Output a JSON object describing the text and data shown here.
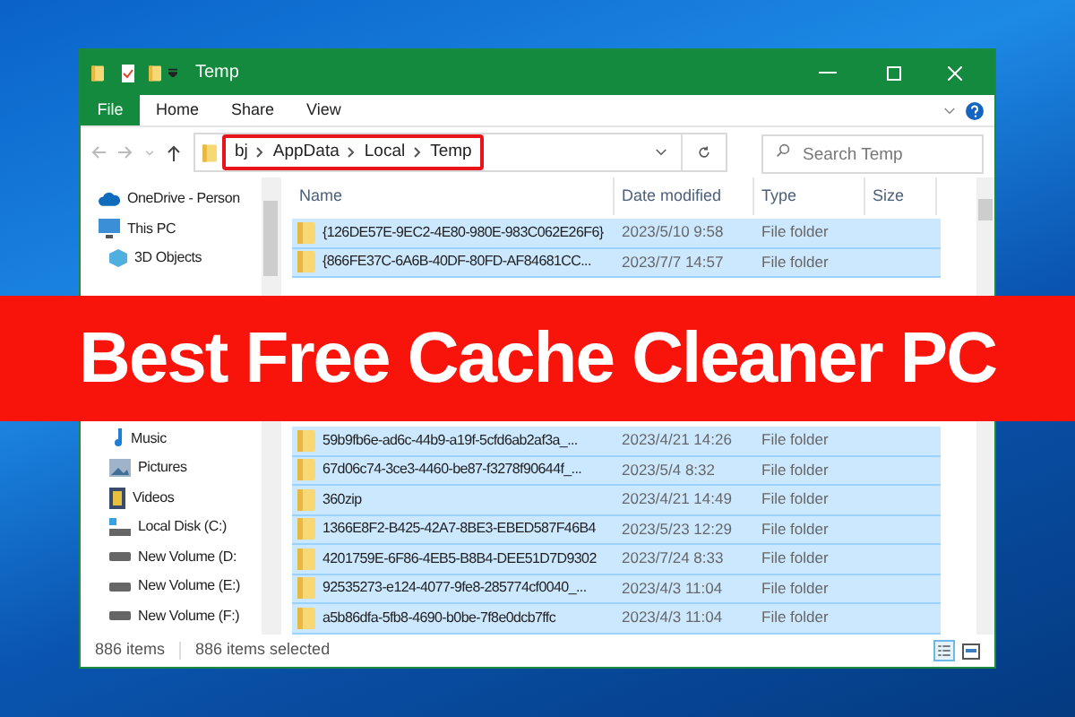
{
  "banner": {
    "headline": "Best Free Cache Cleaner PC"
  },
  "window": {
    "title": "Temp"
  },
  "ribbon": {
    "tabs": [
      {
        "label": "File",
        "kind": "file"
      },
      {
        "label": "Home",
        "kind": "tab"
      },
      {
        "label": "Share",
        "kind": "tab"
      },
      {
        "label": "View",
        "kind": "tab"
      }
    ]
  },
  "address_bar": {
    "breadcrumbs": [
      "bj",
      "AppData",
      "Local",
      "Temp"
    ],
    "highlighted": true
  },
  "search": {
    "placeholder": "Search Temp"
  },
  "sidebar": {
    "items": [
      {
        "label": "OneDrive - Person",
        "kind": "cloud"
      },
      {
        "label": "This PC",
        "kind": "pc",
        "children": [
          {
            "label": "3D Objects",
            "kind": "cube"
          },
          {
            "label": "Music",
            "kind": "music",
            "gap_before": true
          },
          {
            "label": "Pictures",
            "kind": "picture"
          },
          {
            "label": "Videos",
            "kind": "video"
          },
          {
            "label": "Local Disk (C:)",
            "kind": "disk"
          },
          {
            "label": "New Volume (D:",
            "kind": "drive"
          },
          {
            "label": "New Volume (E:)",
            "kind": "drive"
          },
          {
            "label": "New Volume (F:)",
            "kind": "drive"
          }
        ]
      }
    ]
  },
  "table": {
    "columns": [
      "Name",
      "Date modified",
      "Type",
      "Size"
    ],
    "rows": [
      {
        "name": "{126DE57E-9EC2-4E80-980E-983C062E26F6}",
        "date": "2023/5/10 9:58",
        "type": "File folder",
        "selected": true
      },
      {
        "name": "{866FE37C-6A6B-40DF-80FD-AF84681CC...",
        "date": "2023/7/7 14:57",
        "type": "File folder",
        "selected": true
      },
      {
        "name": "59b9fb6e-ad6c-44b9-a19f-5cfd6ab2af3a_...",
        "date": "2023/4/21 14:26",
        "type": "File folder",
        "selected": true,
        "gap_before": true
      },
      {
        "name": "67d06c74-3ce3-4460-be87-f3278f90644f_...",
        "date": "2023/5/4 8:32",
        "type": "File folder",
        "selected": true
      },
      {
        "name": "360zip",
        "date": "2023/4/21 14:49",
        "type": "File folder",
        "selected": true
      },
      {
        "name": "1366E8F2-B425-42A7-8BE3-EBED587F46B4",
        "date": "2023/5/23 12:29",
        "type": "File folder",
        "selected": true
      },
      {
        "name": "4201759E-6F86-4EB5-B8B4-DEE51D7D9302",
        "date": "2023/7/24 8:33",
        "type": "File folder",
        "selected": true
      },
      {
        "name": "92535273-e124-4077-9fe8-285774cf0040_...",
        "date": "2023/4/3 11:04",
        "type": "File folder",
        "selected": true
      },
      {
        "name": "a5b86dfa-5fb8-4690-b0be-7f8e0dcb7ffc",
        "date": "2023/4/3 11:04",
        "type": "File folder",
        "selected": true
      }
    ]
  },
  "status_bar": {
    "count": "886 items",
    "selection": "886 items selected"
  }
}
